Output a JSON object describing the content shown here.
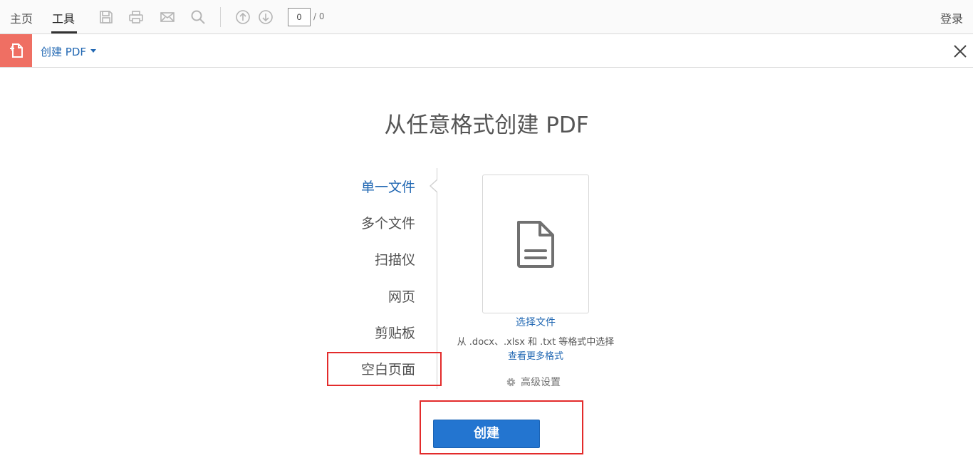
{
  "topbar": {
    "tabs": [
      {
        "label": "主页"
      },
      {
        "label": "工具"
      }
    ],
    "page_current": "0",
    "page_total": "/ 0",
    "login_label": "登录"
  },
  "toolbar": {
    "tool_name": "创建 PDF"
  },
  "main": {
    "title": "从任意格式创建 PDF",
    "options": [
      {
        "label": "单一文件"
      },
      {
        "label": "多个文件"
      },
      {
        "label": "扫描仪"
      },
      {
        "label": "网页"
      },
      {
        "label": "剪贴板"
      },
      {
        "label": "空白页面"
      }
    ],
    "select_file_label": "选择文件",
    "formats_hint": "从 .docx、.xlsx 和 .txt 等格式中选择",
    "more_formats_label": "查看更多格式",
    "advanced_settings_label": "高级设置",
    "create_button_label": "创建"
  },
  "colors": {
    "accent_blue": "#2268b3",
    "button_blue": "#2375d0",
    "tool_badge": "#ef6f63",
    "highlight_red": "#e32b2b"
  }
}
